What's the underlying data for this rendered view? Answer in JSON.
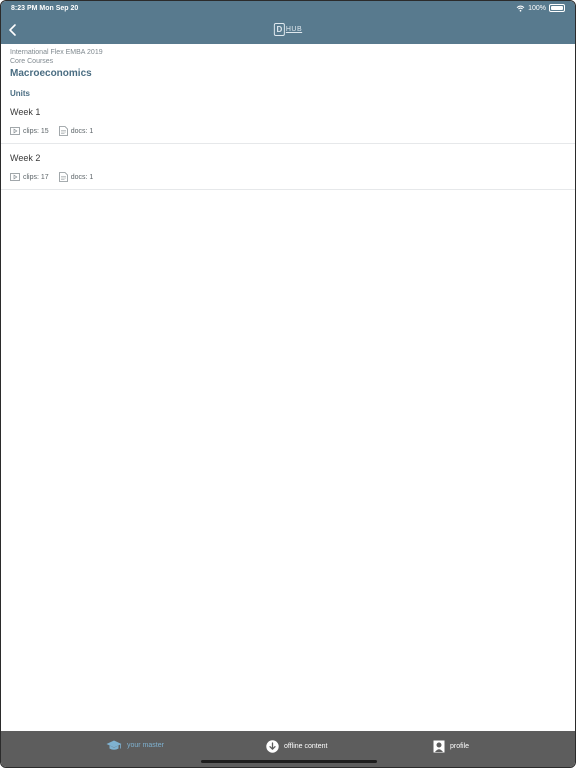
{
  "status_bar": {
    "time_date": "8:23 PM   Mon Sep 20",
    "battery": "100%"
  },
  "header": {
    "logo_mark": "D",
    "logo_text": "HUB"
  },
  "breadcrumb": {
    "program": "International Flex EMBA 2019",
    "section": "Core Courses"
  },
  "course": {
    "title": "Macroeconomics"
  },
  "units": {
    "heading": "Units",
    "items": [
      {
        "title": "Week 1",
        "clips": "clips: 15",
        "docs": "docs: 1"
      },
      {
        "title": "Week 2",
        "clips": "clips: 17",
        "docs": "docs: 1"
      }
    ]
  },
  "tabbar": {
    "master": "your master",
    "offline": "offline content",
    "profile": "profile"
  },
  "colors": {
    "header": "#587a8e",
    "accent": "#4a6d82",
    "tabbar": "#5d5d5d",
    "active_tab": "#7fb2d1"
  }
}
